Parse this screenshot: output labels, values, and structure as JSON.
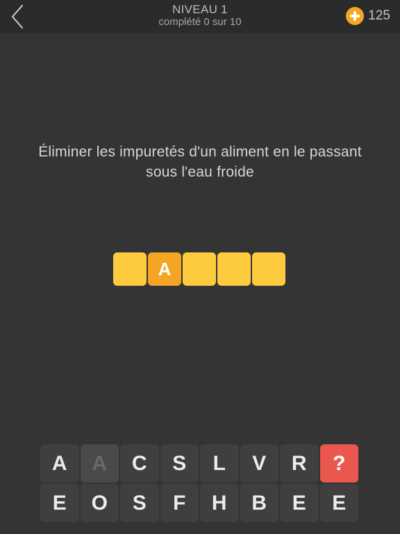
{
  "header": {
    "level_title": "NIVEAU 1",
    "level_progress": "complété 0 sur 10",
    "coins": "125"
  },
  "clue": "Éliminer les impuretés d'un aliment en le passant sous l'eau froide",
  "answer_slots": [
    {
      "letter": "",
      "revealed": false
    },
    {
      "letter": "A",
      "revealed": true
    },
    {
      "letter": "",
      "revealed": false
    },
    {
      "letter": "",
      "revealed": false
    },
    {
      "letter": "",
      "revealed": false
    }
  ],
  "keyboard": {
    "row1": [
      {
        "letter": "A",
        "used": false
      },
      {
        "letter": "A",
        "used": true
      },
      {
        "letter": "C",
        "used": false
      },
      {
        "letter": "S",
        "used": false
      },
      {
        "letter": "L",
        "used": false
      },
      {
        "letter": "V",
        "used": false
      },
      {
        "letter": "R",
        "used": false
      }
    ],
    "hint_label": "?",
    "row2": [
      {
        "letter": "E",
        "used": false
      },
      {
        "letter": "O",
        "used": false
      },
      {
        "letter": "S",
        "used": false
      },
      {
        "letter": "F",
        "used": false
      },
      {
        "letter": "H",
        "used": false
      },
      {
        "letter": "B",
        "used": false
      },
      {
        "letter": "E",
        "used": false
      },
      {
        "letter": "E",
        "used": false
      }
    ]
  },
  "colors": {
    "background": "#343434",
    "topbar": "#2b2b2b",
    "slot": "#fecb3e",
    "slot_revealed": "#f4a524",
    "key": "#3f3f3f",
    "hint_key": "#e9574f",
    "coin": "#f5a623"
  },
  "icons": {
    "back": "chevron-left-icon",
    "coin_add": "plus-circle-icon"
  }
}
